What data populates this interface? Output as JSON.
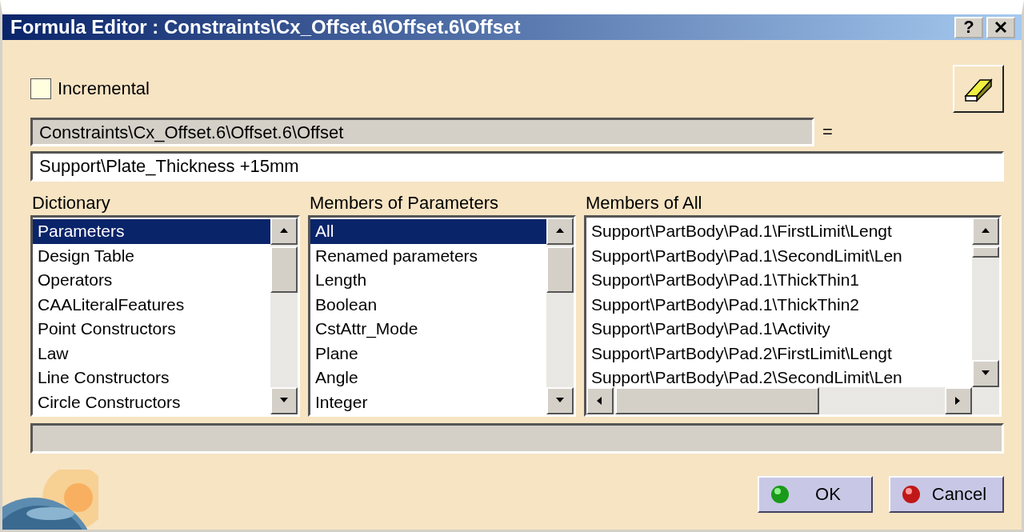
{
  "window": {
    "title": "Formula Editor : Constraints\\Cx_Offset.6\\Offset.6\\Offset",
    "help_button": "?"
  },
  "incremental": {
    "label": "Incremental",
    "checked": false
  },
  "parameter_path": {
    "value": "Constraints\\Cx_Offset.6\\Offset.6\\Offset"
  },
  "equals": "=",
  "formula": {
    "value": "Support\\Plate_Thickness +15mm"
  },
  "lists": [
    {
      "label": "Dictionary",
      "horizontal_scrollbar": false,
      "items": [
        {
          "text": "Parameters",
          "selected": true
        },
        {
          "text": "Design Table",
          "selected": false
        },
        {
          "text": "Operators",
          "selected": false
        },
        {
          "text": "CAALiteralFeatures",
          "selected": false
        },
        {
          "text": "Point Constructors",
          "selected": false
        },
        {
          "text": "Law",
          "selected": false
        },
        {
          "text": "Line Constructors",
          "selected": false
        },
        {
          "text": "Circle Constructors",
          "selected": false
        }
      ]
    },
    {
      "label": "Members of Parameters",
      "horizontal_scrollbar": false,
      "items": [
        {
          "text": "All",
          "selected": true
        },
        {
          "text": "Renamed parameters",
          "selected": false
        },
        {
          "text": "Length",
          "selected": false
        },
        {
          "text": "Boolean",
          "selected": false
        },
        {
          "text": "CstAttr_Mode",
          "selected": false
        },
        {
          "text": "Plane",
          "selected": false
        },
        {
          "text": "Angle",
          "selected": false
        },
        {
          "text": "Integer",
          "selected": false
        }
      ]
    },
    {
      "label": "Members of All",
      "horizontal_scrollbar": true,
      "items": [
        {
          "text": "Support\\PartBody\\Pad.1\\FirstLimit\\Lengt",
          "selected": false
        },
        {
          "text": "Support\\PartBody\\Pad.1\\SecondLimit\\Len",
          "selected": false
        },
        {
          "text": "Support\\PartBody\\Pad.1\\ThickThin1",
          "selected": false
        },
        {
          "text": "Support\\PartBody\\Pad.1\\ThickThin2",
          "selected": false
        },
        {
          "text": "Support\\PartBody\\Pad.1\\Activity",
          "selected": false
        },
        {
          "text": "Support\\PartBody\\Pad.2\\FirstLimit\\Lengt",
          "selected": false
        },
        {
          "text": "Support\\PartBody\\Pad.2\\SecondLimit\\Len",
          "selected": false
        }
      ]
    }
  ],
  "buttons": [
    {
      "label": "OK",
      "kind": "ok"
    },
    {
      "label": "Cancel",
      "kind": "cancel"
    }
  ]
}
